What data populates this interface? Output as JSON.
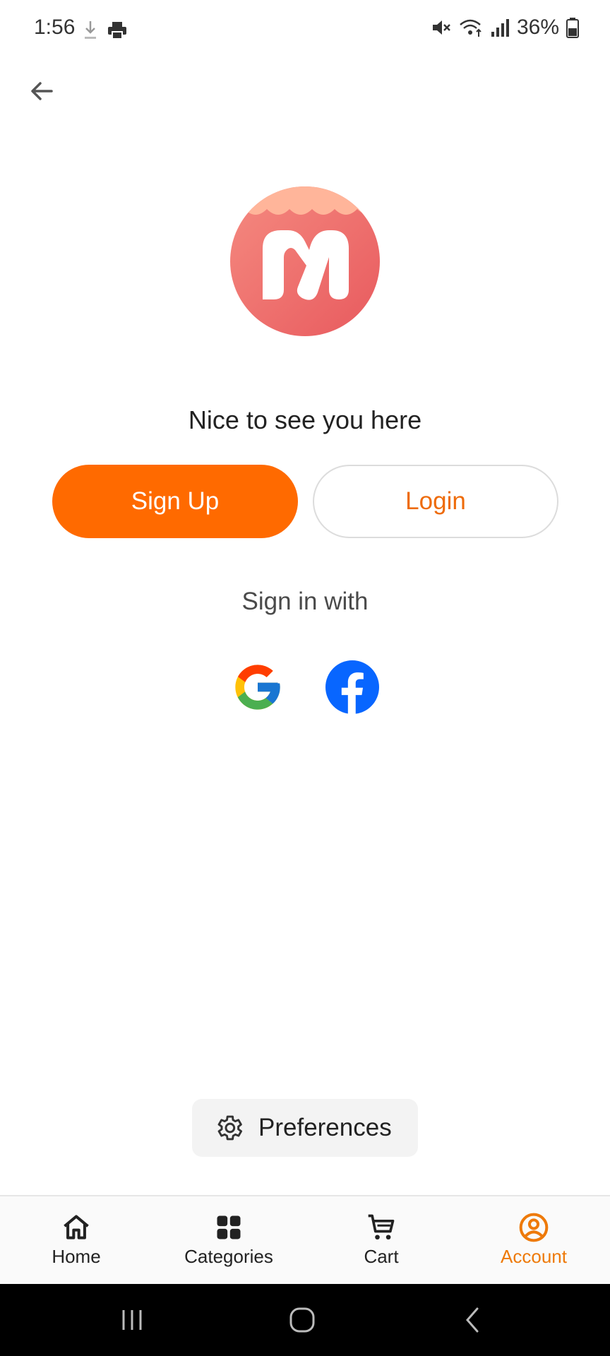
{
  "status": {
    "time": "1:56",
    "battery": "36%",
    "icons": [
      "download-icon",
      "printer-icon",
      "mute-icon",
      "wifi-icon",
      "signal-icon",
      "battery-icon"
    ]
  },
  "colors": {
    "accent": "#ff6a00",
    "accent_text": "#ee6b0a",
    "logo_bg": "#ee6b6b",
    "logo_scallop": "#ffb59a",
    "facebook": "#0866ff"
  },
  "main": {
    "greeting": "Nice to see you here",
    "signup_label": "Sign Up",
    "login_label": "Login",
    "signin_with": "Sign in with",
    "preferences_label": "Preferences"
  },
  "nav": {
    "items": [
      {
        "label": "Home",
        "icon": "home-icon"
      },
      {
        "label": "Categories",
        "icon": "grid-icon"
      },
      {
        "label": "Cart",
        "icon": "cart-icon"
      },
      {
        "label": "Account",
        "icon": "account-icon",
        "active": true
      }
    ]
  }
}
